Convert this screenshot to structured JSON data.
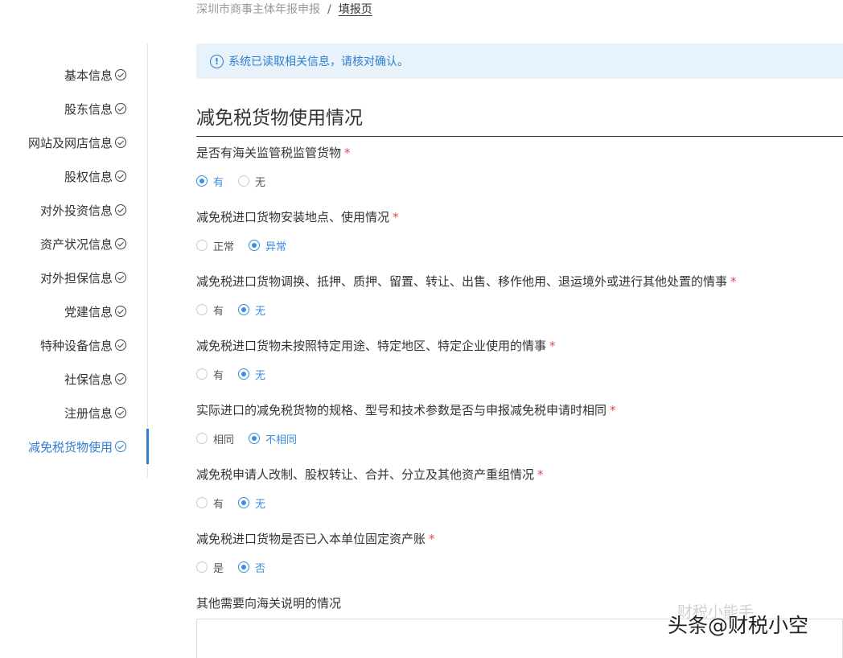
{
  "breadcrumb": {
    "parent": "深圳市商事主体年报申报",
    "separator": "/",
    "current": "填报页"
  },
  "sidebar": {
    "items": [
      {
        "label": "基本信息",
        "active": false
      },
      {
        "label": "股东信息",
        "active": false
      },
      {
        "label": "网站及网店信息",
        "active": false
      },
      {
        "label": "股权信息",
        "active": false
      },
      {
        "label": "对外投资信息",
        "active": false
      },
      {
        "label": "资产状况信息",
        "active": false
      },
      {
        "label": "对外担保信息",
        "active": false
      },
      {
        "label": "党建信息",
        "active": false
      },
      {
        "label": "特种设备信息",
        "active": false
      },
      {
        "label": "社保信息",
        "active": false
      },
      {
        "label": "注册信息",
        "active": false
      },
      {
        "label": "减免税货物使用",
        "active": true
      }
    ]
  },
  "banner": {
    "icon": "info-icon",
    "icon_glyph": "!",
    "text": "系统已读取相关信息，请核对确认。"
  },
  "section": {
    "title": "减免税货物使用情况"
  },
  "questions": [
    {
      "label": "是否有海关监管税监管货物",
      "required": "*",
      "options": [
        "有",
        "无"
      ],
      "selected": 0
    },
    {
      "label": "减免税进口货物安装地点、使用情况",
      "required": "*",
      "options": [
        "正常",
        "异常"
      ],
      "selected": 1
    },
    {
      "label": "减免税进口货物调换、抵押、质押、留置、转让、出售、移作他用、退运境外或进行其他处置的情事",
      "required": "*",
      "options": [
        "有",
        "无"
      ],
      "selected": 1
    },
    {
      "label": "减免税进口货物未按照特定用途、特定地区、特定企业使用的情事",
      "required": "*",
      "options": [
        "有",
        "无"
      ],
      "selected": 1
    },
    {
      "label": "实际进口的减免税货物的规格、型号和技术参数是否与申报减免税申请时相同",
      "required": "*",
      "options": [
        "相同",
        "不相同"
      ],
      "selected": 1
    },
    {
      "label": "减免税申请人改制、股权转让、合并、分立及其他资产重组情况",
      "required": "*",
      "options": [
        "有",
        "无"
      ],
      "selected": 1
    },
    {
      "label": "减免税进口货物是否已入本单位固定资产账",
      "required": "*",
      "options": [
        "是",
        "否"
      ],
      "selected": 1
    }
  ],
  "other": {
    "label": "其他需要向海关说明的情况",
    "value": ""
  },
  "watermark": {
    "text": "头条@财税小空",
    "faint_text": "财税小能手"
  },
  "colors": {
    "accent": "#3a8ee6",
    "required": "#e0484b",
    "banner_bg": "#e8f2fb"
  }
}
